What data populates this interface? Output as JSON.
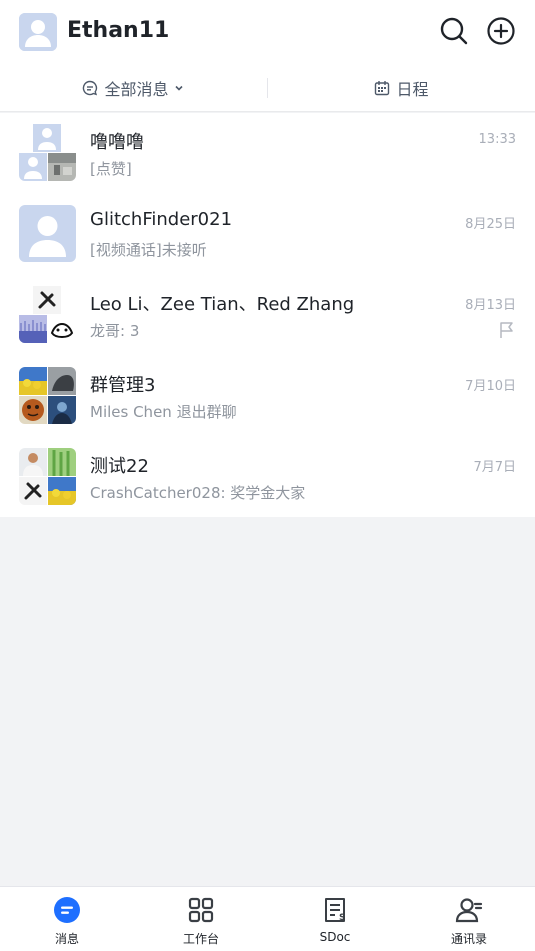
{
  "header": {
    "username": "Ethan11",
    "icons": [
      "search-icon",
      "add-circle-icon"
    ]
  },
  "filters": {
    "messages_label": "全部消息",
    "schedule_label": "日程"
  },
  "conversations": [
    {
      "title": "噜噜噜",
      "subtitle": "[点赞]",
      "time": "13:33",
      "flagged": false
    },
    {
      "title": "GlitchFinder021",
      "subtitle": "[视频通话]未接听",
      "time": "8月25日",
      "flagged": false
    },
    {
      "title": "Leo Li、Zee Tian、Red Zhang",
      "subtitle": "龙哥: 3",
      "time": "8月13日",
      "flagged": true
    },
    {
      "title": "群管理3",
      "subtitle": "Miles Chen 退出群聊",
      "time": "7月10日",
      "flagged": false
    },
    {
      "title": "测试22",
      "subtitle": "CrashCatcher028: 奖学金大家",
      "time": "7月7日",
      "flagged": false
    }
  ],
  "tabs": [
    {
      "label": "消息",
      "icon": "chat-icon",
      "active": true
    },
    {
      "label": "工作台",
      "icon": "grid-icon",
      "active": false
    },
    {
      "label": "SDoc",
      "icon": "doc-icon",
      "active": false
    },
    {
      "label": "通讯录",
      "icon": "contacts-icon",
      "active": false
    }
  ],
  "colors": {
    "accent": "#1e6fff",
    "text_primary": "#1f2329",
    "text_secondary": "#8f959e",
    "background": "#f2f3f5"
  }
}
